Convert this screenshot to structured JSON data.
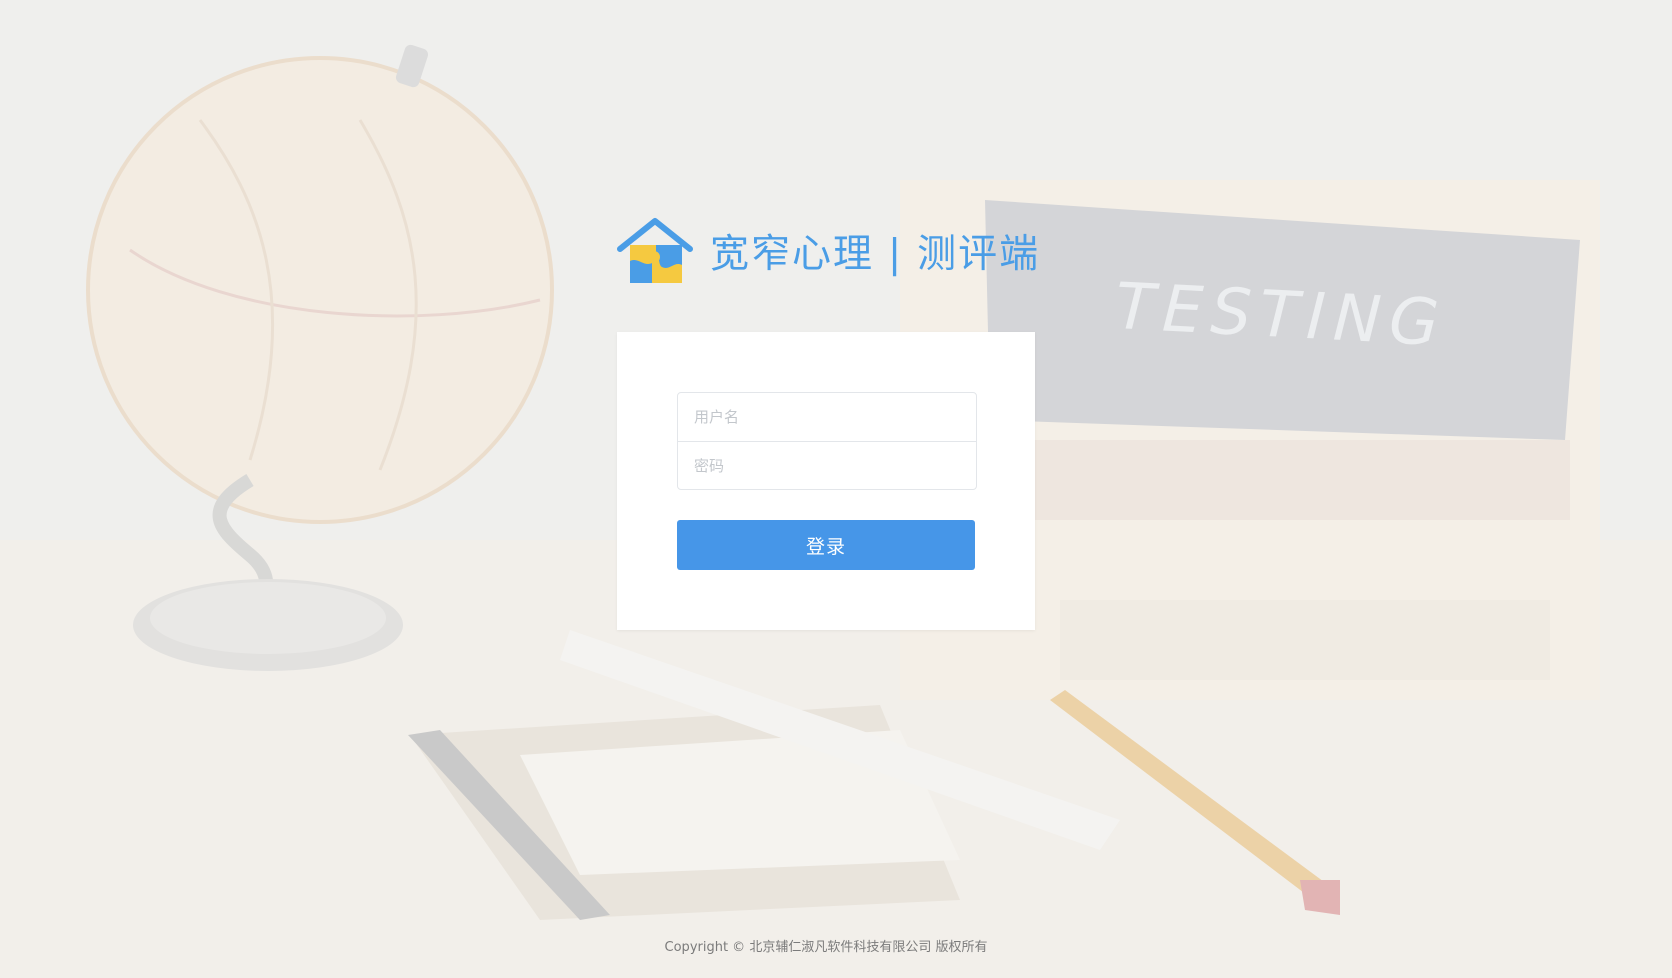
{
  "brand": {
    "name": "宽窄心理",
    "separator": "|",
    "subtitle": "测评端",
    "logo_icon": "house-puzzle-logo",
    "colors": {
      "primary": "#4a9de6",
      "secondary": "#f5c940"
    }
  },
  "background": {
    "chalkboard_text": "TESTING"
  },
  "login": {
    "username_placeholder": "用户名",
    "password_placeholder": "密码",
    "submit_label": "登录",
    "button_color": "#4696e8"
  },
  "footer": {
    "copyright": "Copyright © 北京辅仁淑凡软件科技有限公司 版权所有"
  }
}
